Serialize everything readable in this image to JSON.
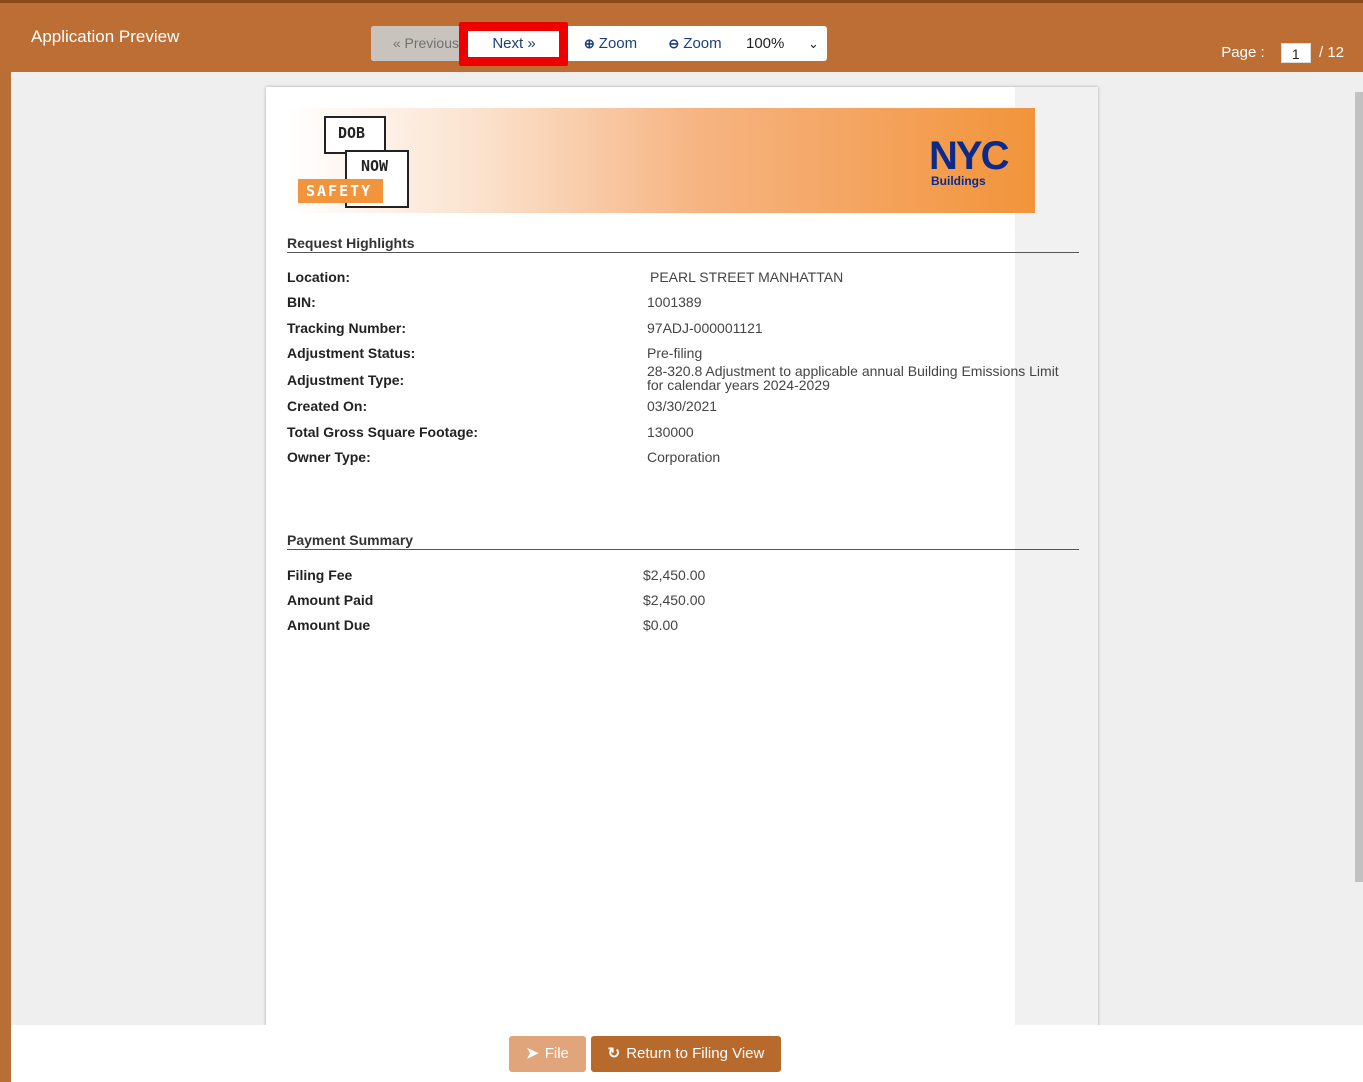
{
  "header": {
    "title": "Application Preview",
    "toolbar": {
      "previous_label": "« Previous",
      "next_label": "Next »",
      "zoom_in_label": "Zoom",
      "zoom_out_label": "Zoom",
      "zoom_value": "100%",
      "zoom_in_icon": "zoom-in-icon",
      "zoom_out_icon": "zoom-out-icon"
    },
    "pager": {
      "label": "Page :",
      "current": "1",
      "separator": "/",
      "total": "12"
    }
  },
  "document": {
    "logo_dob": "DOB",
    "logo_now": "NOW",
    "logo_safety": "SAFETY",
    "logo_nyc": "NYC",
    "logo_buildings": "Buildings",
    "request_highlights": {
      "title": "Request Highlights",
      "rows": [
        {
          "label": "Location:",
          "value": "PEARL STREET  MANHATTAN"
        },
        {
          "label": "BIN:",
          "value": "1001389"
        },
        {
          "label": "Tracking Number:",
          "value": "97ADJ-000001121"
        },
        {
          "label": "Adjustment Status:",
          "value": "Pre-filing"
        },
        {
          "label": "Adjustment Type:",
          "value": "28-320.8 Adjustment to applicable annual Building Emissions Limit for calendar years 2024-2029"
        },
        {
          "label": "Created On:",
          "value": "03/30/2021"
        },
        {
          "label": "Total Gross Square Footage:",
          "value": "130000"
        },
        {
          "label": "Owner Type:",
          "value": "Corporation"
        }
      ]
    },
    "payment_summary": {
      "title": "Payment Summary",
      "rows": [
        {
          "label": "Filing Fee",
          "value": "$2,450.00"
        },
        {
          "label": "Amount Paid",
          "value": "$2,450.00"
        },
        {
          "label": "Amount Due",
          "value": "$0.00"
        }
      ]
    }
  },
  "footer": {
    "file_label": "File",
    "return_label": "Return to Filing View"
  },
  "colors": {
    "header": "#bc6e34",
    "highlight": "#ee0000",
    "link": "#1d3f7a"
  }
}
